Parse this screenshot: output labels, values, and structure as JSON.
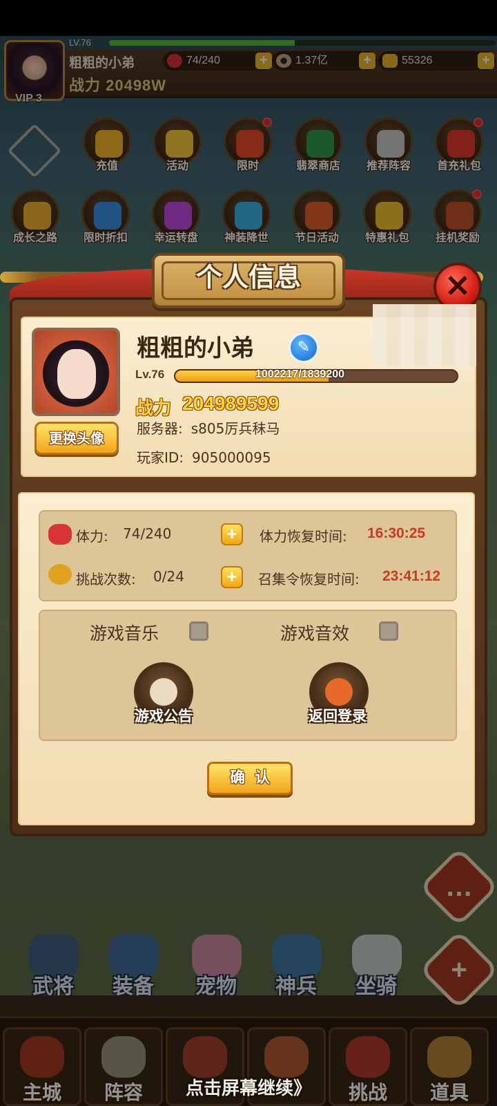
{
  "hud": {
    "level": "LV.76",
    "level_progress": 0.48,
    "name": "粗粗的小弟",
    "power": "战力 20498W",
    "vip": "VIP 3",
    "stamina": "74/240",
    "coins": "1.37亿",
    "ingots": "55326"
  },
  "activities": [
    {
      "label": "充值",
      "icon": "gold-ingots-icon",
      "color": "#f2b528",
      "badge": false
    },
    {
      "label": "活动",
      "icon": "gold-ring-icon",
      "color": "#f4c83a",
      "badge": false
    },
    {
      "label": "限时",
      "icon": "fries-box-icon",
      "color": "#e84a2a",
      "badge": true
    },
    {
      "label": "翡翠商店",
      "icon": "jade-shop-icon",
      "color": "#2f9a4a",
      "badge": false
    },
    {
      "label": "推荐阵容",
      "icon": "crossed-swords-icon",
      "color": "#c9c9c9",
      "badge": false
    },
    {
      "label": "首充礼包",
      "icon": "gift-chest-icon",
      "color": "#e03a2a",
      "badge": true
    },
    {
      "label": "成长之路",
      "icon": "growth-hero-icon",
      "color": "#f0b030",
      "badge": false
    },
    {
      "label": "限时折扣",
      "icon": "hourglass-icon",
      "color": "#3a8fe0",
      "badge": false
    },
    {
      "label": "幸运转盘",
      "icon": "lucky-wheel-icon",
      "color": "#c04ae0",
      "badge": false
    },
    {
      "label": "神装降世",
      "icon": "divine-armor-icon",
      "color": "#3ab0e0",
      "badge": false
    },
    {
      "label": "节日活动",
      "icon": "festival-icon",
      "color": "#e0602a",
      "badge": false
    },
    {
      "label": "特惠礼包",
      "icon": "special-gift-icon",
      "color": "#f0c030",
      "badge": false
    },
    {
      "label": "挂机奖励",
      "icon": "idle-reward-icon",
      "color": "#c0502a",
      "badge": true
    }
  ],
  "dialog": {
    "title": "个人信息",
    "player_name": "粗粗的小弟",
    "level_label": "Lv.76",
    "exp_text": "1002217/1839200",
    "exp_fraction": 0.545,
    "power_label": "战力",
    "power_value": "204989599",
    "server_label": "服务器:",
    "server_value": "s805厉兵秣马",
    "player_id_label": "玩家ID:",
    "player_id_value": "905000095",
    "change_avatar": "更换头像",
    "stamina_label": "体力:",
    "stamina_value": "74/240",
    "stamina_recover_label": "体力恢复时间:",
    "stamina_recover_time": "16:30:25",
    "challenge_label": "挑战次数:",
    "challenge_value": "0/24",
    "summon_recover_label": "召集令恢复时间:",
    "summon_recover_time": "23:41:12",
    "music_label": "游戏音乐",
    "sound_label": "游戏音效",
    "notice_label": "游戏公告",
    "logout_label": "返回登录",
    "confirm_label": "确认"
  },
  "features": [
    "武将",
    "装备",
    "宠物",
    "神兵",
    "坐骑"
  ],
  "tabs": [
    "主城",
    "阵容",
    "",
    "",
    "挑战",
    "道具"
  ],
  "continue_text": "点击屏幕继续》"
}
